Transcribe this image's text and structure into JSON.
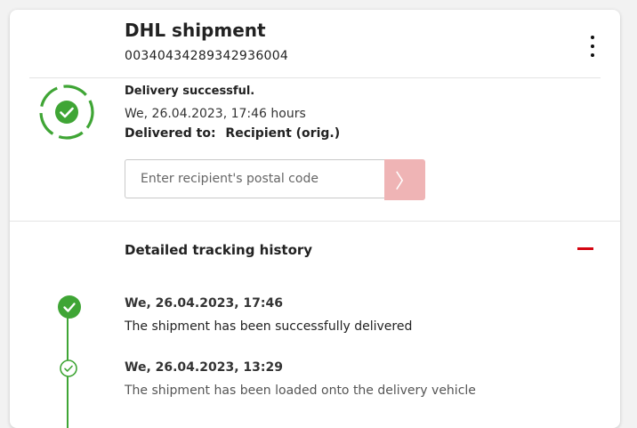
{
  "shipment": {
    "title": "DHL shipment",
    "tracking_number": "00340434289342936004"
  },
  "status": {
    "label": "Delivery successful.",
    "date": "We, 26.04.2023, 17:46 hours",
    "delivered_to_label": "Delivered to:",
    "delivered_to_value": "Recipient (orig.)",
    "color": "#3fa535"
  },
  "postal_code": {
    "placeholder": "Enter recipient's postal code",
    "value": "",
    "button_glyph": "〉",
    "button_color": "#efb4b5"
  },
  "history": {
    "title": "Detailed tracking history",
    "collapse_color": "#d40511",
    "events": [
      {
        "date": "We, 26.04.2023, 17:46",
        "description": "The shipment has been successfully delivered"
      },
      {
        "date": "We, 26.04.2023, 13:29",
        "description": "The shipment has been loaded onto the delivery vehicle"
      }
    ]
  },
  "icons": {
    "menu": "more-vertical-icon",
    "status": "check-circle-icon",
    "submit": "chevron-right-icon",
    "collapse": "minus-icon"
  }
}
